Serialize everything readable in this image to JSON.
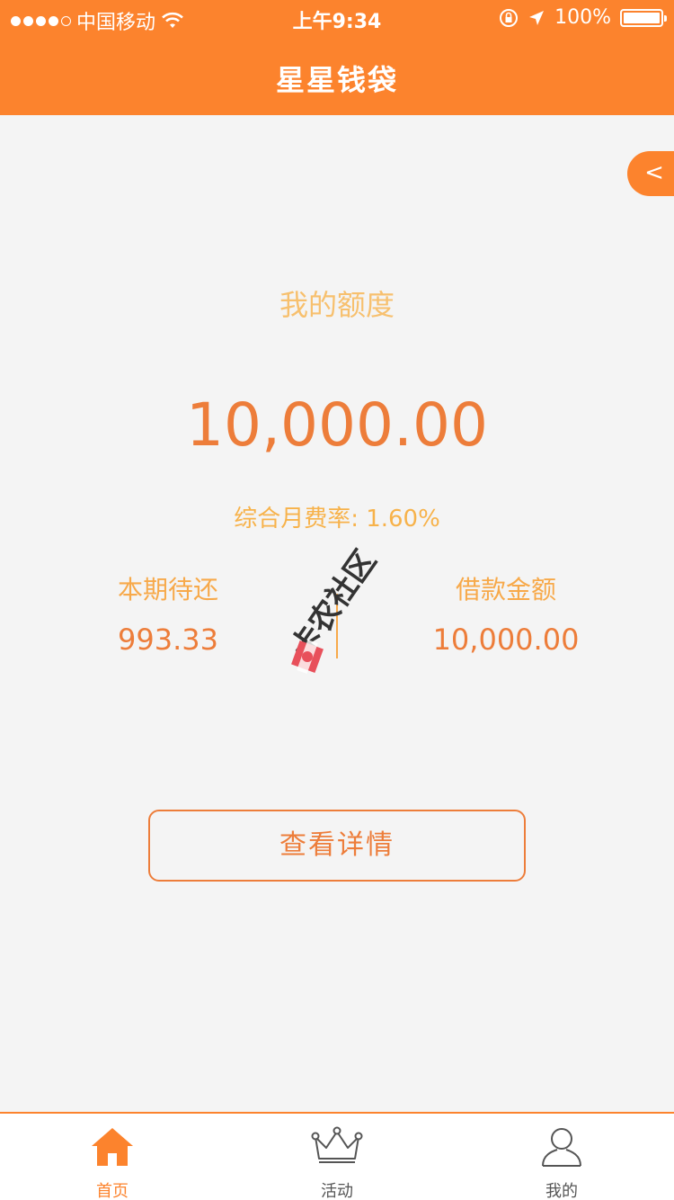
{
  "status_bar": {
    "carrier": "中国移动",
    "time": "上午9:34",
    "battery": "100%"
  },
  "header": {
    "title": "星星钱袋"
  },
  "side_tab": {
    "label": "<"
  },
  "credit": {
    "label": "我的额度",
    "amount": "10,000.00",
    "rate": "综合月费率: 1.60%"
  },
  "summary": {
    "left": {
      "label": "本期待还",
      "value": "993.33"
    },
    "right": {
      "label": "借款金额",
      "value": "10,000.00"
    }
  },
  "watermark": {
    "text": "卡农社区"
  },
  "details_button": {
    "label": "查看详情"
  },
  "tabbar": {
    "items": [
      {
        "label": "首页",
        "icon": "home-icon",
        "active": true
      },
      {
        "label": "活动",
        "icon": "crown-icon",
        "active": false
      },
      {
        "label": "我的",
        "icon": "user-icon",
        "active": false
      }
    ]
  },
  "colors": {
    "brand": "#fc832d",
    "amount": "#ed7d3a",
    "label": "#f7a94a"
  }
}
